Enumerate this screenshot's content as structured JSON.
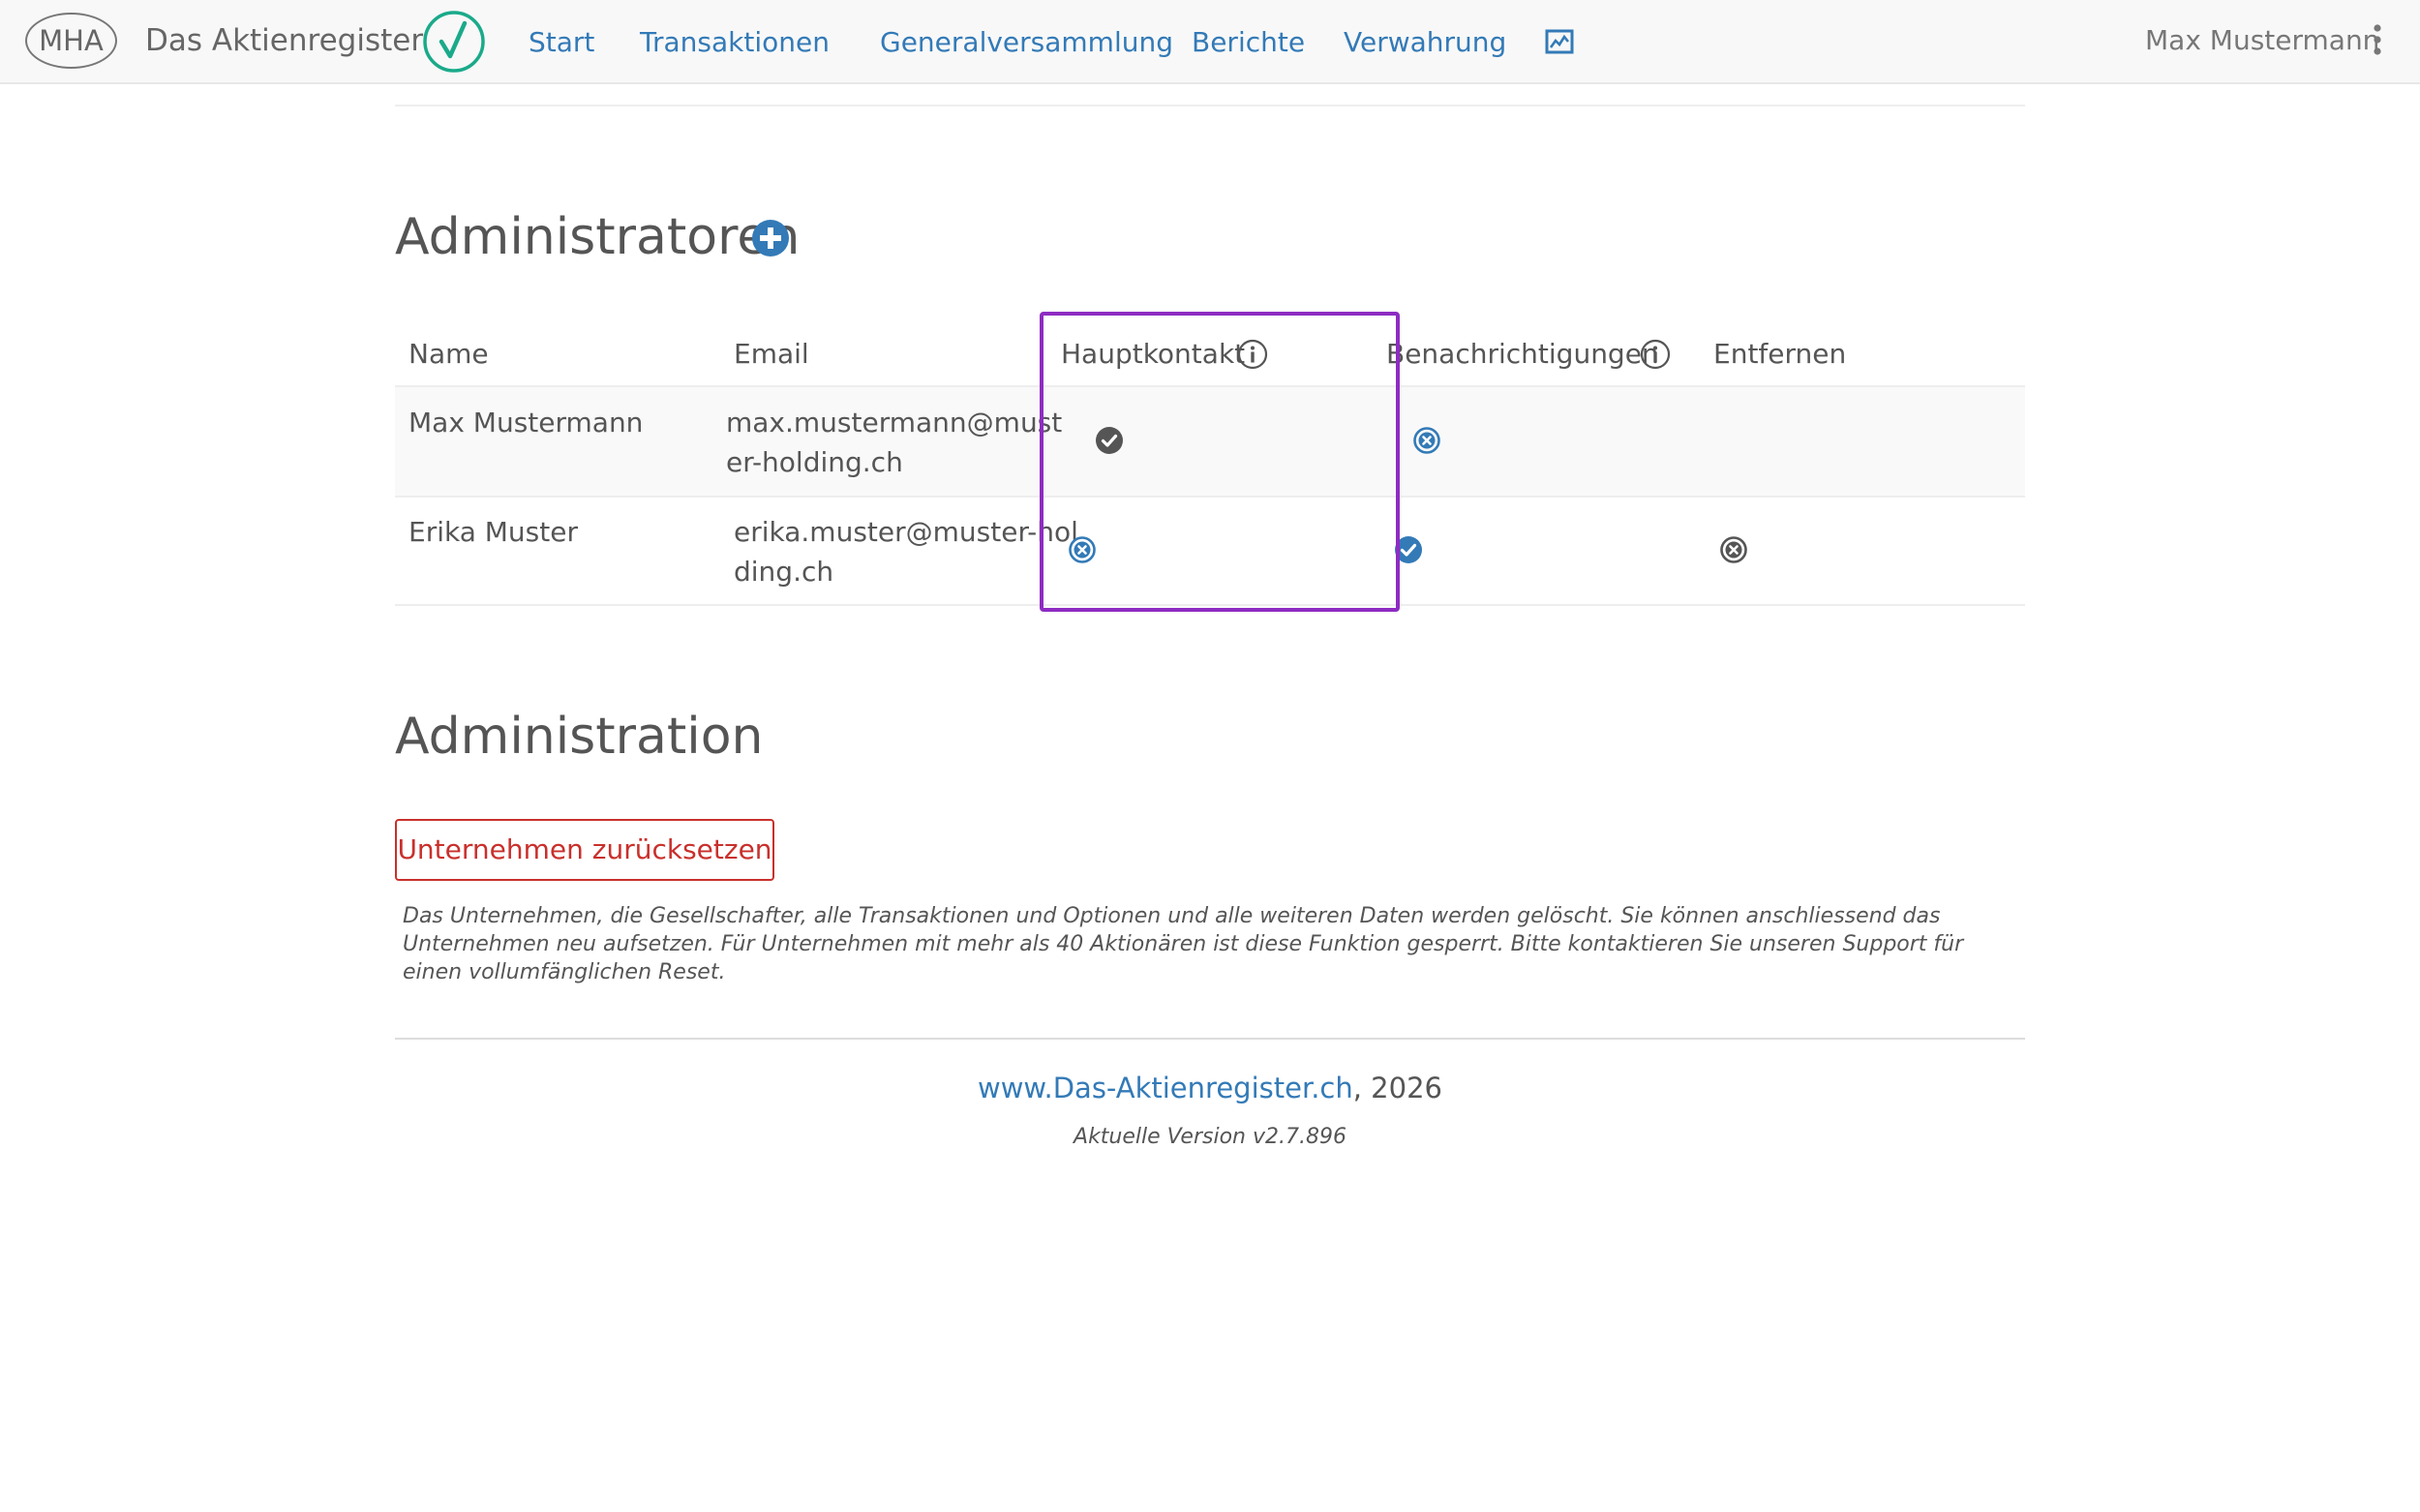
{
  "navbar": {
    "logo_text": "MHA",
    "brand_title": "Das Aktienregister",
    "links": [
      "Start",
      "Transaktionen",
      "Generalversammlung",
      "Berichte",
      "Verwahrung"
    ],
    "user_name": "Max Mustermann"
  },
  "colors": {
    "link": "#337ab7",
    "brand_check": "#1aaa8a",
    "danger": "#c9302c",
    "highlight": "#8e2cc2",
    "check_gray": "#555555"
  },
  "admins": {
    "heading": "Administratoren",
    "columns": {
      "name": "Name",
      "email": "Email",
      "hauptkontakt": "Hauptkontakt",
      "benachrichtigungen": "Benachrichtigungen",
      "entfernen": "Entfernen"
    },
    "rows": [
      {
        "name": "Max Mustermann",
        "email": "max.mustermann@muster-holding.ch",
        "hauptkontakt": "check-gray-icon",
        "benachrichtigungen": "x-circle-blue-icon",
        "entfernen": ""
      },
      {
        "name": "Erika Muster",
        "email": "erika.muster@muster-holding.ch",
        "hauptkontakt": "x-circle-blue-icon",
        "benachrichtigungen": "check-blue-icon",
        "entfernen": "x-circle-gray-icon"
      }
    ]
  },
  "administration": {
    "heading": "Administration",
    "reset_button": "Unternehmen zurücksetzen",
    "reset_note": "Das Unternehmen, die Gesellschafter, alle Transaktionen und Optionen und alle weiteren Daten werden gelöscht. Sie können anschliessend das Unternehmen neu aufsetzen. Für Unternehmen mit mehr als 40 Aktionären ist diese Funktion gesperrt. Bitte kontaktieren Sie unseren Support für einen vollumfänglichen Reset."
  },
  "footer": {
    "link_text": "www.Das-Aktienregister.ch",
    "year_suffix": ", 2026",
    "version": "Aktuelle Version v2.7.896"
  }
}
